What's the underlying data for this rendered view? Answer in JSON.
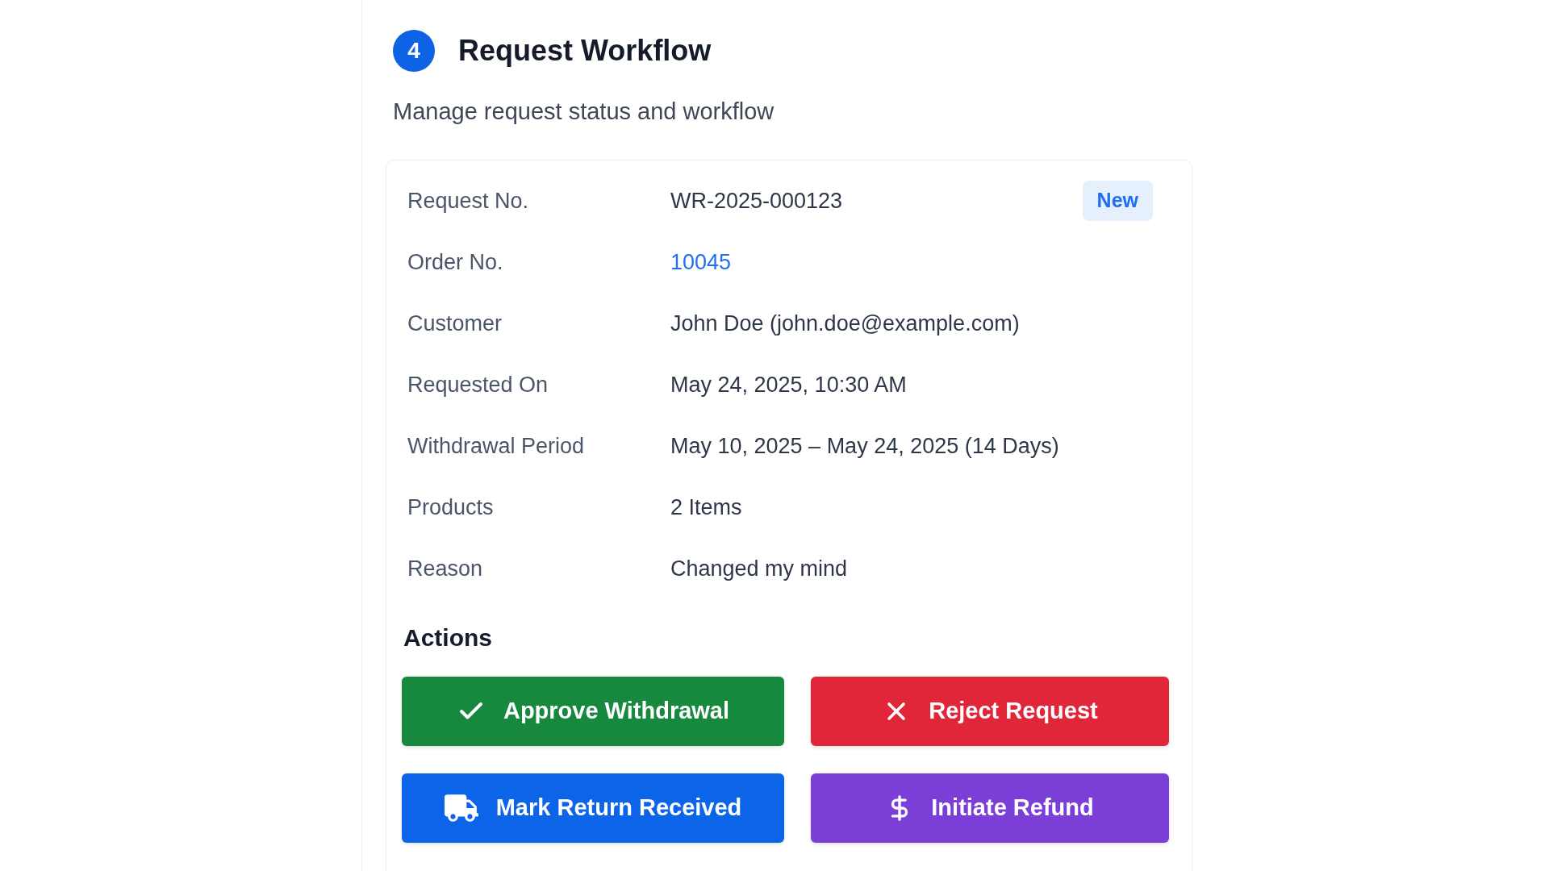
{
  "section": {
    "step": "4",
    "title": "Request Workflow",
    "subtitle": "Manage request status and workflow"
  },
  "details": {
    "rows": [
      {
        "label": "Request No.",
        "value": "WR-2025-000123",
        "kind": "text",
        "badge": "New"
      },
      {
        "label": "Order No.",
        "value": "10045",
        "kind": "link"
      },
      {
        "label": "Customer",
        "value": "John Doe (john.doe@example.com)",
        "kind": "text"
      },
      {
        "label": "Requested On",
        "value": "May 24, 2025, 10:30 AM",
        "kind": "text"
      },
      {
        "label": "Withdrawal Period",
        "value": "May 10, 2025 – May 24, 2025 (14 Days)",
        "kind": "text"
      },
      {
        "label": "Products",
        "value": "2 Items",
        "kind": "text"
      },
      {
        "label": "Reason",
        "value": "Changed my mind",
        "kind": "text"
      }
    ]
  },
  "actions": {
    "title": "Actions",
    "buttons": [
      {
        "label": "Approve Withdrawal",
        "kind": "approve"
      },
      {
        "label": "Reject Request",
        "kind": "reject"
      },
      {
        "label": "Mark Return Received",
        "kind": "receive"
      },
      {
        "label": "Initiate Refund",
        "kind": "refund"
      }
    ]
  }
}
